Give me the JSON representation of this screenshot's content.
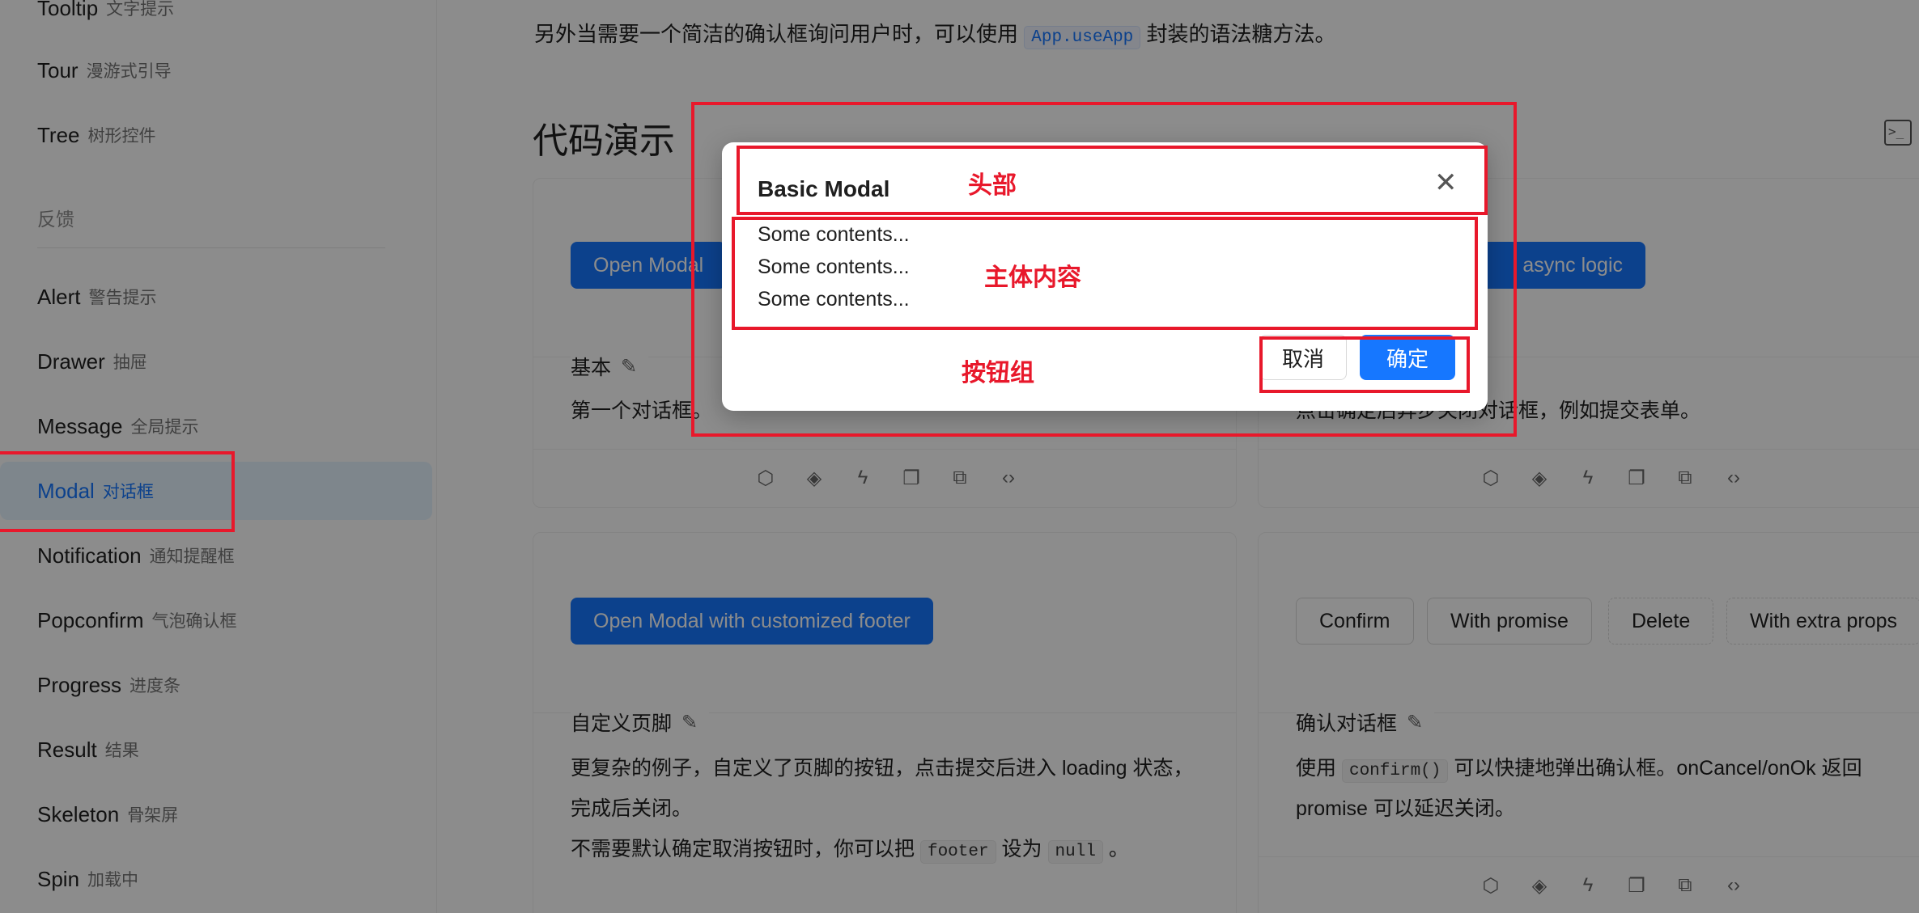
{
  "sidebar": {
    "items_top": [
      {
        "en": "Tooltip",
        "cn": "文字提示"
      },
      {
        "en": "Tour",
        "cn": "漫游式引导"
      },
      {
        "en": "Tree",
        "cn": "树形控件"
      }
    ],
    "group_label": "反馈",
    "items_feedback": [
      {
        "en": "Alert",
        "cn": "警告提示"
      },
      {
        "en": "Drawer",
        "cn": "抽屉"
      },
      {
        "en": "Message",
        "cn": "全局提示"
      },
      {
        "en": "Modal",
        "cn": "对话框"
      },
      {
        "en": "Notification",
        "cn": "通知提醒框"
      },
      {
        "en": "Popconfirm",
        "cn": "气泡确认框"
      },
      {
        "en": "Progress",
        "cn": "进度条"
      },
      {
        "en": "Result",
        "cn": "结果"
      },
      {
        "en": "Skeleton",
        "cn": "骨架屏"
      },
      {
        "en": "Spin",
        "cn": "加载中"
      }
    ]
  },
  "main": {
    "intro_pre": "另外当需要一个简洁的确认框询问用户时，可以使用",
    "intro_code": "App.useApp",
    "intro_post": "封装的语法糖方法。",
    "section_title": "代码演示",
    "card1": {
      "button": "Open Modal",
      "title": "基本",
      "desc": "第一个对话框。"
    },
    "card2": {
      "button": "Open Modal with async logic",
      "button_visible": "async logic",
      "desc": "点击确定后异步关闭对话框，例如提交表单。"
    },
    "card3": {
      "button": "Open Modal with customized footer",
      "title": "自定义页脚",
      "desc1": "更复杂的例子，自定义了页脚的按钮，点击提交后进入 loading 状态，完成后关闭。",
      "desc2_pre": "不需要默认确定取消按钮时，你可以把",
      "desc2_code1": "footer",
      "desc2_mid": "设为",
      "desc2_code2": "null",
      "desc2_post": "。"
    },
    "card4": {
      "buttons": [
        "Confirm",
        "With promise",
        "Delete",
        "With extra props"
      ],
      "title": "确认对话框",
      "desc_pre": "使用",
      "desc_code": "confirm()",
      "desc_post": "可以快捷地弹出确认框。onCancel/onOk 返回",
      "desc_line2": "promise 可以延迟关闭。"
    },
    "action_icons": [
      "cube-icon",
      "codepen-icon",
      "thunder-icon",
      "copy-icon",
      "external-link-icon",
      "code-icon"
    ]
  },
  "modal": {
    "title": "Basic Modal",
    "contents": [
      "Some contents...",
      "Some contents...",
      "Some contents..."
    ],
    "cancel": "取消",
    "ok": "确定"
  },
  "annotations": {
    "header": "头部",
    "body": "主体内容",
    "footer": "按钮组"
  },
  "colors": {
    "primary": "#1677ff",
    "annotation_red": "#e8182b",
    "active_bg": "#e6f4ff"
  }
}
